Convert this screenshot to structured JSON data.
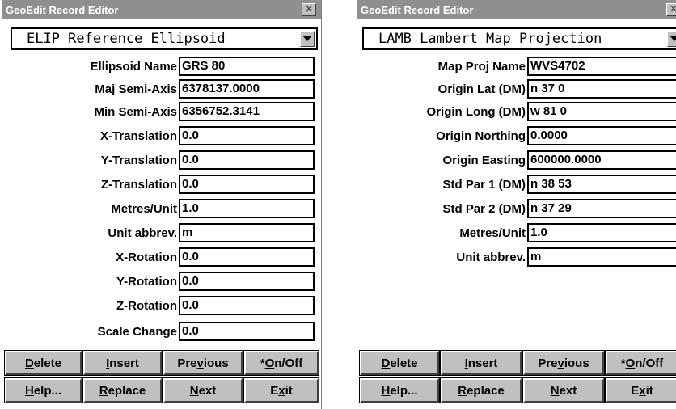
{
  "windows": [
    {
      "title": "GeoEdit Record Editor",
      "record_type": "ELIP Reference Ellipsoid",
      "fields": [
        {
          "label": "Ellipsoid Name",
          "value": "GRS 80"
        },
        {
          "label": "Maj Semi-Axis",
          "value": "6378137.0000"
        },
        {
          "label": "Min Semi-Axis",
          "value": "6356752.3141"
        },
        {
          "label": "X-Translation",
          "value": "0.0"
        },
        {
          "label": "Y-Translation",
          "value": "0.0"
        },
        {
          "label": "Z-Translation",
          "value": "0.0"
        },
        {
          "label": "Metres/Unit",
          "value": "1.0"
        },
        {
          "label": "Unit abbrev.",
          "value": "m"
        },
        {
          "label": "X-Rotation",
          "value": "0.0"
        },
        {
          "label": "Y-Rotation",
          "value": "0.0"
        },
        {
          "label": "Z-Rotation",
          "value": "0.0"
        },
        {
          "label": "Scale Change",
          "value": "0.0"
        }
      ],
      "buttons": {
        "delete": {
          "mnemonic": "D",
          "rest": "elete"
        },
        "insert": {
          "mnemonic": "I",
          "rest": "nsert"
        },
        "previous": {
          "pre": "Pre",
          "mnemonic": "v",
          "rest": "ious"
        },
        "onoff": {
          "pre": "*",
          "mnemonic": "O",
          "rest": "n/Off"
        },
        "help": {
          "mnemonic": "H",
          "rest": "elp..."
        },
        "replace": {
          "mnemonic": "R",
          "rest": "eplace"
        },
        "next": {
          "mnemonic": "N",
          "rest": "ext"
        },
        "exit": {
          "pre": "E",
          "mnemonic": "x",
          "rest": "it"
        }
      }
    },
    {
      "title": "GeoEdit Record Editor",
      "record_type": "LAMB Lambert Map Projection",
      "fields": [
        {
          "label": "Map Proj Name",
          "value": "WVS4702"
        },
        {
          "label": "Origin Lat (DM)",
          "value": "n 37  0"
        },
        {
          "label": "Origin Long (DM)",
          "value": "w 81  0"
        },
        {
          "label": "Origin Northing",
          "value": "0.0000"
        },
        {
          "label": "Origin Easting",
          "value": "600000.0000"
        },
        {
          "label": "Std Par 1 (DM)",
          "value": "n 38 53"
        },
        {
          "label": "Std Par 2 (DM)",
          "value": "n 37 29"
        },
        {
          "label": "Metres/Unit",
          "value": "1.0"
        },
        {
          "label": "Unit abbrev.",
          "value": "m"
        }
      ],
      "buttons": {
        "delete": {
          "mnemonic": "D",
          "rest": "elete"
        },
        "insert": {
          "mnemonic": "I",
          "rest": "nsert"
        },
        "previous": {
          "pre": "Pre",
          "mnemonic": "v",
          "rest": "ious"
        },
        "onoff": {
          "pre": "*",
          "mnemonic": "O",
          "rest": "n/Off"
        },
        "help": {
          "mnemonic": "H",
          "rest": "elp..."
        },
        "replace": {
          "mnemonic": "R",
          "rest": "eplace"
        },
        "next": {
          "mnemonic": "N",
          "rest": "ext"
        },
        "exit": {
          "pre": "E",
          "mnemonic": "x",
          "rest": "it"
        }
      }
    }
  ],
  "icons": {
    "close": "close-icon",
    "dropdown": "chevron-down-icon"
  },
  "colors": {
    "titlebar": "#8f8f8f",
    "button_face": "#c0c0c0",
    "field_border": "#000000"
  }
}
